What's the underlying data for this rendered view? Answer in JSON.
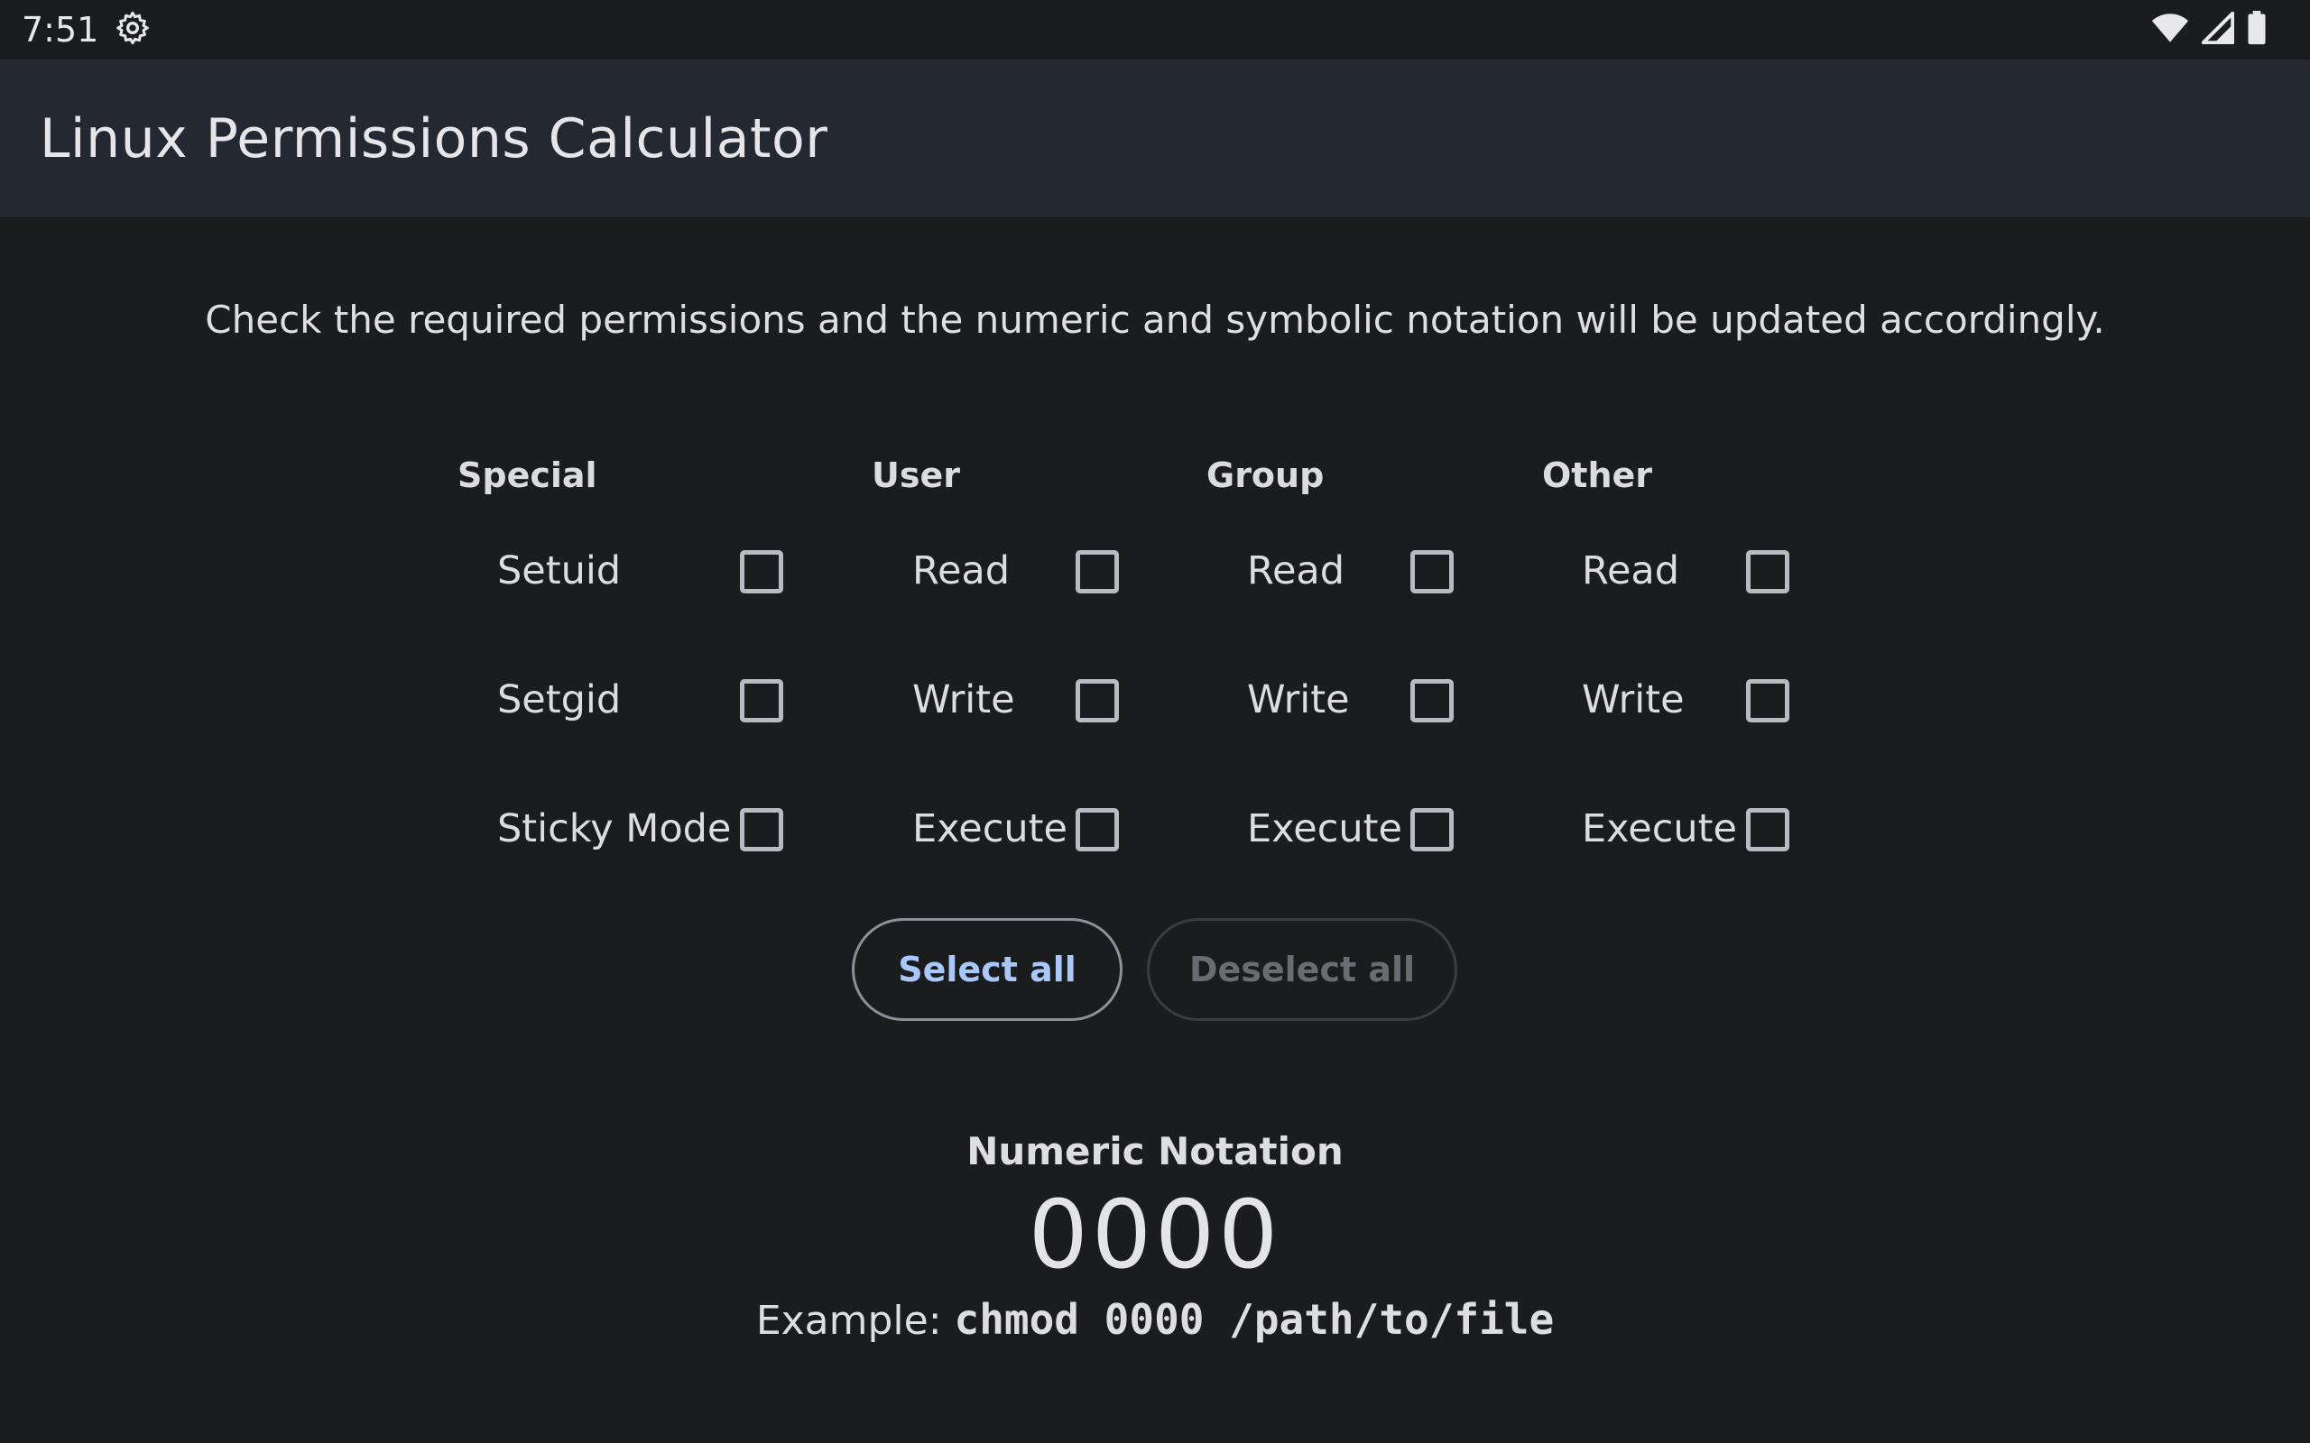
{
  "status_bar": {
    "time": "7:51",
    "icons": [
      "settings-gear-icon",
      "wifi-icon",
      "cellular-signal-icon",
      "battery-icon"
    ]
  },
  "app_bar": {
    "title": "Linux Permissions Calculator"
  },
  "description": "Check the required permissions and the numeric and symbolic notation will be updated accordingly.",
  "groups": {
    "special": {
      "header": "Special",
      "items": [
        {
          "label": "Setuid",
          "checked": false
        },
        {
          "label": "Setgid",
          "checked": false
        },
        {
          "label": "Sticky Mode",
          "checked": false
        }
      ]
    },
    "user": {
      "header": "User",
      "items": [
        {
          "label": "Read",
          "checked": false
        },
        {
          "label": "Write",
          "checked": false
        },
        {
          "label": "Execute",
          "checked": false
        }
      ]
    },
    "group": {
      "header": "Group",
      "items": [
        {
          "label": "Read",
          "checked": false
        },
        {
          "label": "Write",
          "checked": false
        },
        {
          "label": "Execute",
          "checked": false
        }
      ]
    },
    "other": {
      "header": "Other",
      "items": [
        {
          "label": "Read",
          "checked": false
        },
        {
          "label": "Write",
          "checked": false
        },
        {
          "label": "Execute",
          "checked": false
        }
      ]
    }
  },
  "buttons": {
    "select_all": "Select all",
    "deselect_all": "Deselect all"
  },
  "numeric": {
    "title": "Numeric Notation",
    "value": "0000",
    "example_prefix": "Example: ",
    "example_command": "chmod 0000 /path/to/file"
  },
  "colors": {
    "background": "#1b1c1e",
    "app_bar": "#242931",
    "accent": "#a8c7fa",
    "checkbox_border": "#b9bbc2"
  }
}
